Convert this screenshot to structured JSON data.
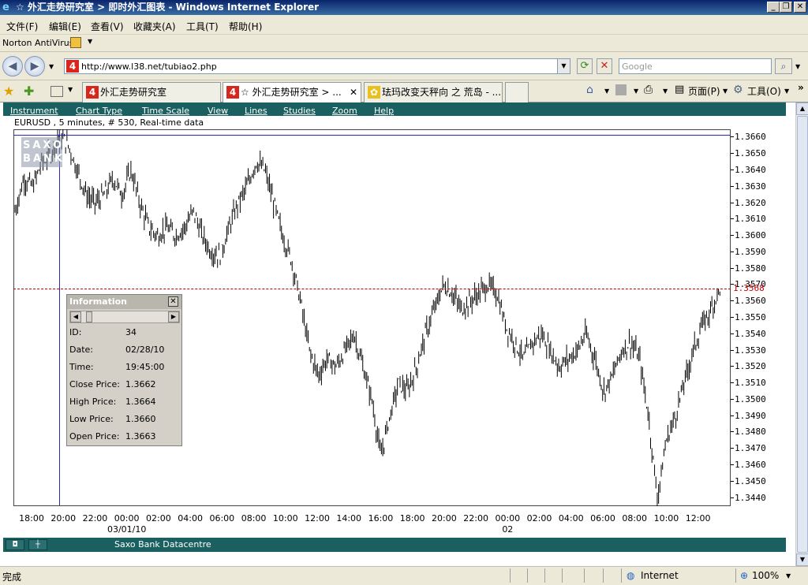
{
  "window": {
    "title": "☆ 外汇走势研究室 > 即时外汇图表 - Windows Internet Explorer"
  },
  "menubar": {
    "items": [
      "文件(F)",
      "编辑(E)",
      "查看(V)",
      "收藏夹(A)",
      "工具(T)",
      "帮助(H)"
    ]
  },
  "norton": {
    "label": "Norton AntiVirus"
  },
  "address": {
    "url": "http://www.l38.net/tubiao2.php",
    "search_placeholder": "Google"
  },
  "tabs": [
    {
      "label": "外汇走势研究室",
      "active": false
    },
    {
      "label": "☆ 外汇走势研究室 > ...",
      "active": true
    },
    {
      "label": "珐玛改变天秤向 之 荒岛 - ...",
      "active": false
    }
  ],
  "commandbar": {
    "page_label": "页面(P)",
    "tools_label": "工具(O)"
  },
  "app": {
    "menu": [
      "Instrument",
      "Chart Type",
      "Time Scale",
      "View",
      "Lines",
      "Studies",
      "Zoom",
      "Help"
    ],
    "chart_info": "EURUSD , 5 minutes, # 530, Real-time data",
    "logo": [
      "SAXO",
      "BANK"
    ],
    "current_price_label": "1.3568",
    "status_label": "Saxo Bank Datacentre"
  },
  "info_panel": {
    "title": "Information",
    "rows": [
      {
        "label": "ID:",
        "value": "34"
      },
      {
        "label": "Date:",
        "value": "02/28/10"
      },
      {
        "label": "Time:",
        "value": "19:45:00"
      },
      {
        "label": "Close Price:",
        "value": "1.3662"
      },
      {
        "label": "High Price:",
        "value": "1.3664"
      },
      {
        "label": "Low Price:",
        "value": "1.3660"
      },
      {
        "label": "Open Price:",
        "value": "1.3663"
      }
    ]
  },
  "chart_data": {
    "type": "bar",
    "symbol": "EURUSD",
    "interval": "5 minutes",
    "bars": 530,
    "ylim": [
      1.3435,
      1.3665
    ],
    "y_ticks": [
      "1.3660",
      "1.3650",
      "1.3640",
      "1.3630",
      "1.3620",
      "1.3610",
      "1.3600",
      "1.3590",
      "1.3580",
      "1.3570",
      "1.3560",
      "1.3550",
      "1.3540",
      "1.3530",
      "1.3520",
      "1.3510",
      "1.3500",
      "1.3490",
      "1.3480",
      "1.3470",
      "1.3460",
      "1.3450",
      "1.3440"
    ],
    "x_ticks": [
      "18:00",
      "20:00",
      "22:00",
      "00:00",
      "02:00",
      "04:00",
      "06:00",
      "08:00",
      "10:00",
      "12:00",
      "14:00",
      "16:00",
      "18:00",
      "20:00",
      "22:00",
      "00:00",
      "02:00",
      "04:00",
      "06:00",
      "08:00",
      "10:00",
      "12:00"
    ],
    "x_dates": [
      {
        "label": "03/01/10",
        "at_tick": 3
      },
      {
        "label": "02",
        "at_tick": 15
      }
    ],
    "current_price": 1.3568,
    "price_path": [
      1.3615,
      1.3635,
      1.363,
      1.3645,
      1.365,
      1.3662,
      1.3655,
      1.364,
      1.3625,
      1.362,
      1.3625,
      1.3635,
      1.3625,
      1.364,
      1.362,
      1.3605,
      1.36,
      1.3605,
      1.36,
      1.3605,
      1.3615,
      1.36,
      1.359,
      1.3588,
      1.3605,
      1.362,
      1.363,
      1.3645,
      1.364,
      1.362,
      1.36,
      1.3585,
      1.356,
      1.353,
      1.3515,
      1.3525,
      1.352,
      1.353,
      1.354,
      1.352,
      1.35,
      1.3465,
      1.349,
      1.351,
      1.3505,
      1.352,
      1.354,
      1.3555,
      1.357,
      1.3565,
      1.3555,
      1.356,
      1.3565,
      1.357,
      1.3565,
      1.3545,
      1.3535,
      1.3525,
      1.3535,
      1.354,
      1.353,
      1.352,
      1.3525,
      1.353,
      1.354,
      1.3525,
      1.3505,
      1.3515,
      1.353,
      1.3535,
      1.3525,
      1.349,
      1.344,
      1.3475,
      1.349,
      1.351,
      1.353,
      1.3545,
      1.3555,
      1.3568
    ]
  },
  "statusbar": {
    "left": "完成",
    "zone": "Internet",
    "zoom": "100%"
  }
}
